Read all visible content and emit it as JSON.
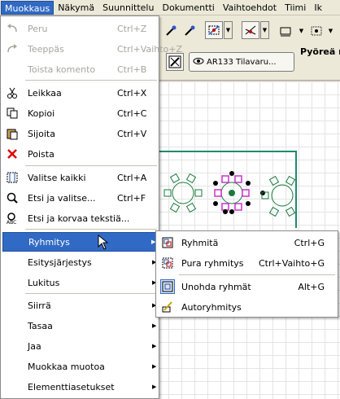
{
  "menubar": {
    "items": [
      {
        "label": "Muokkaus",
        "active": true
      },
      {
        "label": "Näkymä"
      },
      {
        "label": "Suunnittelu"
      },
      {
        "label": "Dokumentti"
      },
      {
        "label": "Vaihtoehdot"
      },
      {
        "label": "Tiimi"
      },
      {
        "label": "Ik"
      }
    ]
  },
  "toolbar": {
    "layer_combo": "AR133 Tilavaru...",
    "info_label": "Pyöreä ru"
  },
  "main_menu": {
    "items": [
      {
        "label": "Peru",
        "shortcut": "Ctrl+Z",
        "icon": "undo-icon",
        "disabled": true
      },
      {
        "label": "Teeppäs",
        "shortcut": "Ctrl+Vaihto+Z",
        "icon": "redo-icon",
        "disabled": true
      },
      {
        "label": "Toista komento",
        "shortcut": "Ctrl+B",
        "icon": "",
        "disabled": true
      },
      {
        "label": "Leikkaa",
        "shortcut": "Ctrl+X",
        "icon": "scissors-icon"
      },
      {
        "label": "Kopioi",
        "shortcut": "Ctrl+C",
        "icon": "copy-icon"
      },
      {
        "label": "Sijoita",
        "shortcut": "Ctrl+V",
        "icon": "paste-icon"
      },
      {
        "label": "Poista",
        "shortcut": "",
        "icon": "delete-icon"
      },
      {
        "label": "Valitse kaikki",
        "shortcut": "Ctrl+A",
        "icon": "select-all-icon"
      },
      {
        "label": "Etsi ja valitse...",
        "shortcut": "Ctrl+F",
        "icon": "find-select-icon"
      },
      {
        "label": "Etsi ja korvaa tekstiä...",
        "shortcut": "",
        "icon": "find-replace-text-icon"
      },
      {
        "label": "Ryhmitys",
        "submenu": true,
        "highlighted": true
      },
      {
        "label": "Esitysjärjestys",
        "submenu": true
      },
      {
        "label": "Lukitus",
        "submenu": true
      },
      {
        "label": "Siirrä",
        "submenu": true
      },
      {
        "label": "Tasaa",
        "submenu": true
      },
      {
        "label": "Jaa",
        "submenu": true
      },
      {
        "label": "Muokkaa muotoa",
        "submenu": true
      },
      {
        "label": "Elementtiasetukset",
        "submenu": true
      }
    ]
  },
  "sub_menu": {
    "items": [
      {
        "label": "Ryhmitä",
        "shortcut": "Ctrl+G",
        "icon": "group-icon"
      },
      {
        "label": "Pura ryhmitys",
        "shortcut": "Ctrl+Vaihto+G",
        "icon": "ungroup-icon"
      },
      {
        "label": "Unohda ryhmät",
        "shortcut": "Alt+G",
        "icon": "suspend-groups-icon"
      },
      {
        "label": "Autoryhmitys",
        "shortcut": "",
        "icon": "autogroup-icon"
      }
    ]
  },
  "colors": {
    "highlight": "#316ac5",
    "wall": "#1f8a6c",
    "furniture": "#1a7a3a",
    "selection": "#cc33cc"
  }
}
